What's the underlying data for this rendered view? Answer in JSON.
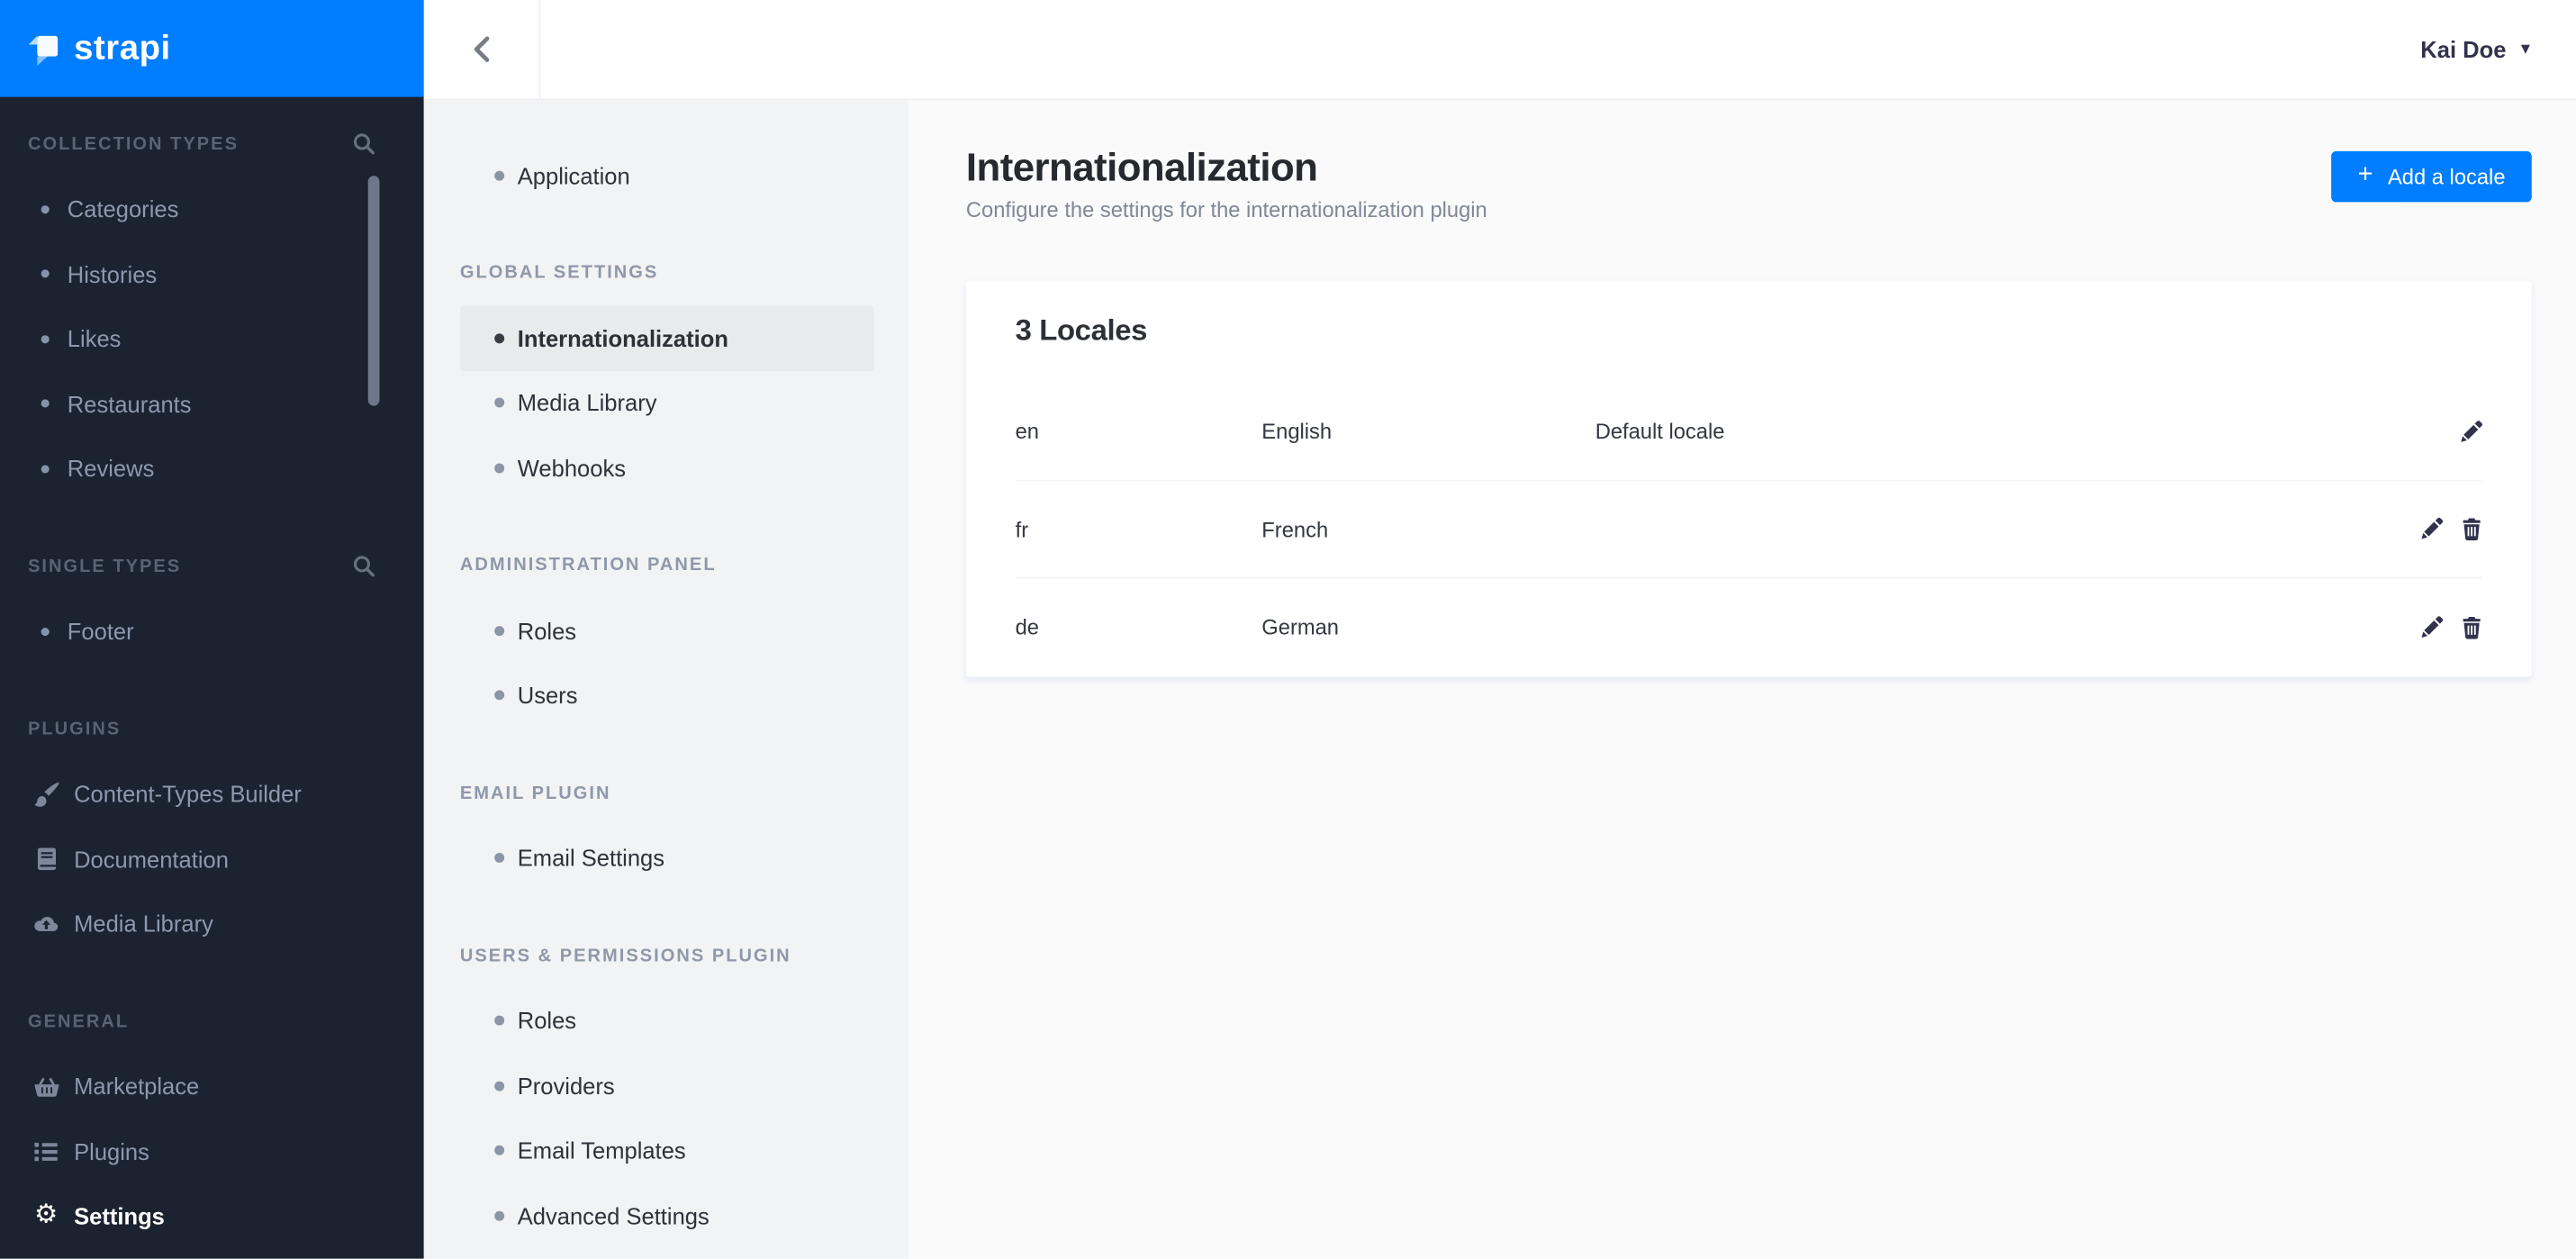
{
  "colors": {
    "brand_blue": "#007eff",
    "sidebar_bg": "#1b2230",
    "subnav_bg": "#f2f3f4",
    "subnav_active_bg": "#e9eaec",
    "content_bg": "#fafafb",
    "card_bg": "#ffffff",
    "text_dark": "#333740",
    "text_muted": "#808795"
  },
  "brand": {
    "name": "strapi",
    "logo_icon": "strapi-logo-icon"
  },
  "topbar": {
    "back_icon": "chevron-left-icon",
    "user": {
      "name": "Kai Doe",
      "caret_icon": "caret-down-icon",
      "caret_glyph": "▾"
    }
  },
  "left_sidebar": {
    "sections": [
      {
        "label": "COLLECTION TYPES",
        "search_icon": "search-icon",
        "items": [
          {
            "label": "Categories"
          },
          {
            "label": "Histories"
          },
          {
            "label": "Likes"
          },
          {
            "label": "Restaurants"
          },
          {
            "label": "Reviews"
          }
        ]
      },
      {
        "label": "SINGLE TYPES",
        "search_icon": "search-icon",
        "items": [
          {
            "label": "Footer"
          }
        ]
      },
      {
        "label": "PLUGINS",
        "items": [
          {
            "label": "Content-Types Builder",
            "icon": "brush-icon"
          },
          {
            "label": "Documentation",
            "icon": "book-icon"
          },
          {
            "label": "Media Library",
            "icon": "cloud-upload-icon"
          }
        ]
      },
      {
        "label": "GENERAL",
        "items": [
          {
            "label": "Marketplace",
            "icon": "basket-icon"
          },
          {
            "label": "Plugins",
            "icon": "list-icon"
          },
          {
            "label": "Settings",
            "icon": "gear-icon",
            "active": true,
            "gear_glyph": "⚙"
          }
        ]
      }
    ]
  },
  "settings_sidebar": {
    "top_items": [
      {
        "label": "Application"
      }
    ],
    "sections": [
      {
        "label": "GLOBAL SETTINGS",
        "items": [
          {
            "label": "Internationalization",
            "active": true
          },
          {
            "label": "Media Library"
          },
          {
            "label": "Webhooks"
          }
        ]
      },
      {
        "label": "ADMINISTRATION PANEL",
        "items": [
          {
            "label": "Roles"
          },
          {
            "label": "Users"
          }
        ]
      },
      {
        "label": "EMAIL PLUGIN",
        "items": [
          {
            "label": "Email Settings"
          }
        ]
      },
      {
        "label": "USERS & PERMISSIONS PLUGIN",
        "items": [
          {
            "label": "Roles"
          },
          {
            "label": "Providers"
          },
          {
            "label": "Email Templates"
          },
          {
            "label": "Advanced Settings"
          }
        ]
      }
    ]
  },
  "main": {
    "title": "Internationalization",
    "subtitle": "Configure the settings for the internationalization plugin",
    "add_locale_button": {
      "plus": "+",
      "label": "Add a locale"
    },
    "locales_card": {
      "title": "3 Locales",
      "rows": [
        {
          "code": "en",
          "name": "English",
          "note": "Default locale"
        },
        {
          "code": "fr",
          "name": "French",
          "note": ""
        },
        {
          "code": "de",
          "name": "German",
          "note": ""
        }
      ]
    }
  }
}
